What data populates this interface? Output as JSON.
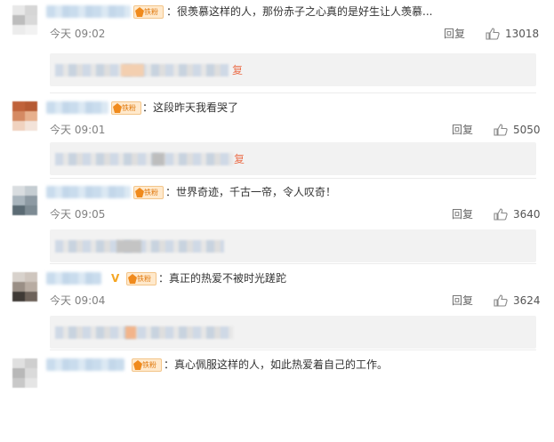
{
  "comments": [
    {
      "text": "：很羡慕这样的人，那份赤子之心真的是好生让人羡慕...",
      "time": "今天 09:02",
      "reply_label": "回复",
      "likes": "13018",
      "fan_badge": "铁粉",
      "expand_label": "复"
    },
    {
      "text": "：这段昨天我看哭了",
      "time": "今天 09:01",
      "reply_label": "回复",
      "likes": "5050",
      "fan_badge": "铁粉",
      "expand_label": "复"
    },
    {
      "text": "：世界奇迹，千古一帝，令人叹奇！",
      "time": "今天 09:05",
      "reply_label": "回复",
      "likes": "3640",
      "fan_badge": "铁粉"
    },
    {
      "text": "：真正的热爱不被时光蹉跎",
      "time": "今天 09:04",
      "reply_label": "回复",
      "likes": "3624",
      "fan_badge": "铁粉",
      "verified_mark": "V"
    },
    {
      "text": "：真心佩服这样的人，如此热爱着自己的工作。",
      "fan_badge": "铁粉"
    }
  ],
  "colors": {
    "username_blur": "#c9dced",
    "badge_orange": "#e07a10",
    "link_orange": "#eb7350",
    "time_gray": "#808080",
    "sub_bg": "#f2f2f2"
  }
}
